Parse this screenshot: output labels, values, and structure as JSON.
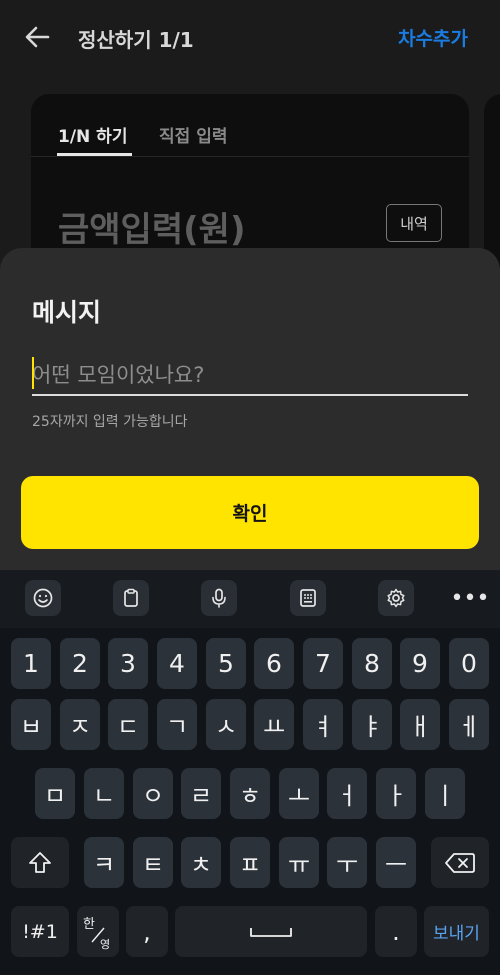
{
  "header": {
    "title": "정산하기 1/1",
    "add_round": "차수추가"
  },
  "card": {
    "tabs": [
      {
        "label": "1/N 하기"
      },
      {
        "label": "직접 입력"
      }
    ],
    "amount_label": "금액입력(원)",
    "history_button": "내역"
  },
  "sheet": {
    "title": "메시지",
    "input_placeholder": "어떤 모임이었나요?",
    "input_value": "",
    "hint": "25자까지 입력 가능합니다",
    "confirm": "확인"
  },
  "keyboard": {
    "toolbar_icons": [
      "emoji-icon",
      "clipboard-icon",
      "microphone-icon",
      "keypad-icon",
      "gear-icon",
      "more-icon"
    ],
    "row_numbers": [
      "1",
      "2",
      "3",
      "4",
      "5",
      "6",
      "7",
      "8",
      "9",
      "0"
    ],
    "row1": [
      "ㅂ",
      "ㅈ",
      "ㄷ",
      "ㄱ",
      "ㅅ",
      "ㅛ",
      "ㅕ",
      "ㅑ",
      "ㅐ",
      "ㅔ"
    ],
    "row2": [
      "ㅁ",
      "ㄴ",
      "ㅇ",
      "ㄹ",
      "ㅎ",
      "ㅗ",
      "ㅓ",
      "ㅏ",
      "ㅣ"
    ],
    "row3": [
      "ㅋ",
      "ㅌ",
      "ㅊ",
      "ㅍ",
      "ㅠ",
      "ㅜ",
      "ㅡ"
    ],
    "symbols_key": "!#1",
    "lang_key_top": "한",
    "lang_key_bottom": "영",
    "comma_key": ",",
    "period_key": ".",
    "send_key": "보내기",
    "more_key": "•••"
  },
  "colors": {
    "accent": "#ffe400",
    "link": "#1a7be0",
    "sheet": "#2c2c2c",
    "keyboard": "#111419"
  }
}
